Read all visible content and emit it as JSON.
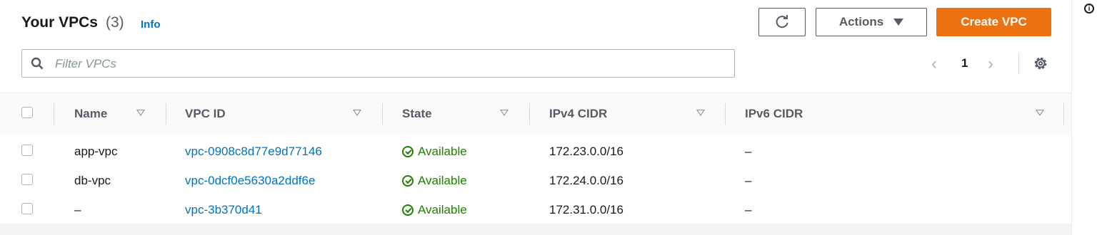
{
  "header": {
    "title": "Your VPCs",
    "count": "(3)",
    "info": "Info"
  },
  "toolbar": {
    "actions_label": "Actions",
    "create_label": "Create VPC"
  },
  "search": {
    "placeholder": "Filter VPCs",
    "value": ""
  },
  "pagination": {
    "page": "1"
  },
  "columns": [
    "Name",
    "VPC ID",
    "State",
    "IPv4 CIDR",
    "IPv6 CIDR"
  ],
  "rows": [
    {
      "name": "app-vpc",
      "vpc_id": "vpc-0908c8d77e9d77146",
      "state": "Available",
      "ipv4": "172.23.0.0/16",
      "ipv6": "–"
    },
    {
      "name": "db-vpc",
      "vpc_id": "vpc-0dcf0e5630a2ddf6e",
      "state": "Available",
      "ipv4": "172.24.0.0/16",
      "ipv6": "–"
    },
    {
      "name": "–",
      "vpc_id": "vpc-3b370d41",
      "state": "Available",
      "ipv4": "172.31.0.0/16",
      "ipv6": "–"
    }
  ],
  "icons": {
    "refresh": "refresh-icon",
    "search": "search-icon",
    "settings": "gear-icon",
    "info": "info-icon",
    "status": "check-circle-icon"
  },
  "colors": {
    "primary": "#ec7211",
    "link": "#0073bb",
    "success": "#1d8102"
  }
}
